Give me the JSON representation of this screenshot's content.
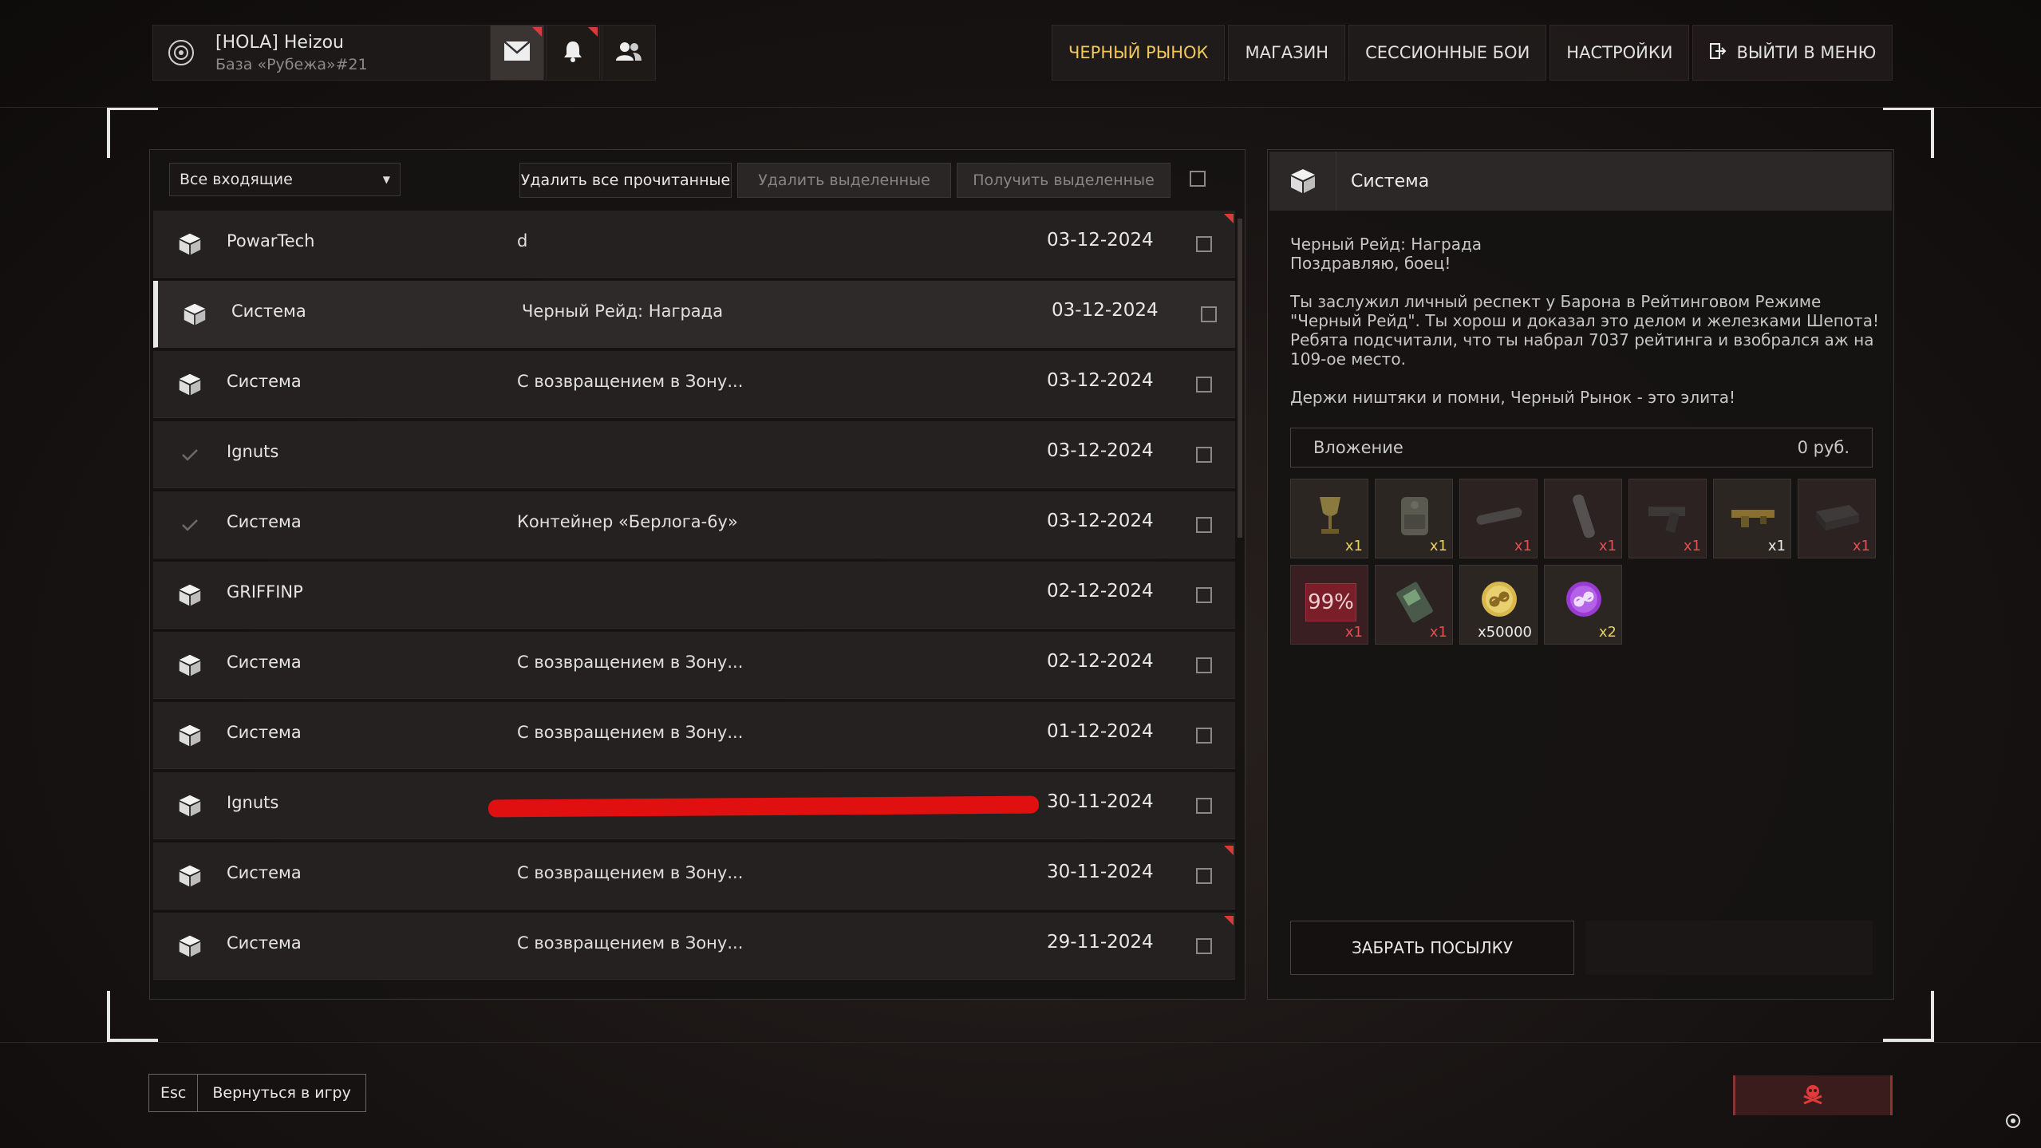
{
  "profile": {
    "name": "[HOLA] Heizou",
    "base": "База «Рубежа»#21"
  },
  "nav": {
    "items": [
      {
        "label": "ЧЕРНЫЙ РЫНОК",
        "active": true
      },
      {
        "label": "МАГАЗИН"
      },
      {
        "label": "СЕССИОННЫЕ БОИ"
      },
      {
        "label": "НАСТРОЙКИ"
      },
      {
        "label": "ВЫЙТИ В МЕНЮ",
        "icon": "exit-icon"
      }
    ]
  },
  "toolbar": {
    "filter_value": "Все входящие",
    "delete_read_label": "Удалить все прочитанные",
    "delete_selected_label": "Удалить выделенные",
    "get_selected_label": "Получить выделенные"
  },
  "mail": [
    {
      "sender": "PowarTech",
      "subject": "d",
      "date": "03-12-2024",
      "icon": "box-icon",
      "unread": true
    },
    {
      "sender": "Система",
      "subject": "Черный Рейд: Награда",
      "date": "03-12-2024",
      "icon": "box-icon",
      "selected": true
    },
    {
      "sender": "Система",
      "subject": "С возвращением в Зону...",
      "date": "03-12-2024",
      "icon": "box-icon"
    },
    {
      "sender": "Ignuts",
      "subject": "",
      "date": "03-12-2024",
      "icon": "check-icon"
    },
    {
      "sender": "Система",
      "subject": "Контейнер «Берлога-6у»",
      "date": "03-12-2024",
      "icon": "check-icon"
    },
    {
      "sender": "GRIFFINP",
      "subject": "",
      "date": "02-12-2024",
      "icon": "box-icon"
    },
    {
      "sender": "Система",
      "subject": "С возвращением в Зону...",
      "date": "02-12-2024",
      "icon": "box-icon"
    },
    {
      "sender": "Система",
      "subject": "С возвращением в Зону...",
      "date": "01-12-2024",
      "icon": "box-icon"
    },
    {
      "sender": "Ignuts",
      "subject": "",
      "date": "30-11-2024",
      "icon": "box-icon",
      "redacted": true
    },
    {
      "sender": "Система",
      "subject": "С возвращением в Зону...",
      "date": "30-11-2024",
      "icon": "box-icon",
      "unread": true
    },
    {
      "sender": "Система",
      "subject": "С возвращением в Зону...",
      "date": "29-11-2024",
      "icon": "box-icon",
      "unread": true
    }
  ],
  "message": {
    "sender": "Система",
    "title_line": "Черный Рейд: Награда",
    "greeting": "Поздравляю, боец!",
    "body1": "Ты заслужил личный респект у Барона в Рейтинговом Режиме \"Черный Рейд\". Ты хорош и доказал это делом и железками Шепота!",
    "body2": "Ребята подсчитали, что ты набрал 7037 рейтинга и взобрался аж на 109-ое место.",
    "body3": "Держи ништяки и помни, Черный Рынок - это элита!",
    "attachment_label": "Вложение",
    "attachment_price": "0 руб.",
    "items": [
      {
        "name": "goblet-icon",
        "qty": "x1",
        "qty_color": "#e8d060",
        "bg": "#2b2622"
      },
      {
        "name": "backpack-icon",
        "qty": "x1",
        "qty_color": "#e8d060",
        "bg": "#2b2622"
      },
      {
        "name": "tube-icon",
        "qty": "x1",
        "qty_color": "#e05050",
        "bg": "#2c2222"
      },
      {
        "name": "cylinder-icon",
        "qty": "x1",
        "qty_color": "#e05050",
        "bg": "#2c2222"
      },
      {
        "name": "pistol-icon",
        "qty": "x1",
        "qty_color": "#e05050",
        "bg": "#2c2222"
      },
      {
        "name": "weapon-mod-icon",
        "qty": "x1",
        "qty_color": "#eaeaea",
        "bg": "#2b2622"
      },
      {
        "name": "case-icon",
        "qty": "x1",
        "qty_color": "#e05050",
        "bg": "#2c2222"
      },
      {
        "name": "repair-99-icon",
        "label": "99%",
        "qty": "x1",
        "qty_color": "#e05050",
        "bg": "#3a1f22"
      },
      {
        "name": "device-icon",
        "qty": "x1",
        "qty_color": "#e05050",
        "bg": "#2c2222"
      },
      {
        "name": "gold-token-icon",
        "qty": "x50000",
        "qty_color": "#eaeaea",
        "bg": "#2b2622"
      },
      {
        "name": "purple-token-icon",
        "qty": "x2",
        "qty_color": "#e8d060",
        "bg": "#2b2622"
      }
    ],
    "claim_label": "ЗАБРАТЬ ПОСЫЛКУ"
  },
  "footer": {
    "esc_key": "Esc",
    "return_label": "Вернуться в игру"
  },
  "colors": {
    "accent_yellow": "#f0c75e",
    "flag_red": "#d93a3a",
    "danger_bg": "#3a1c1c"
  }
}
